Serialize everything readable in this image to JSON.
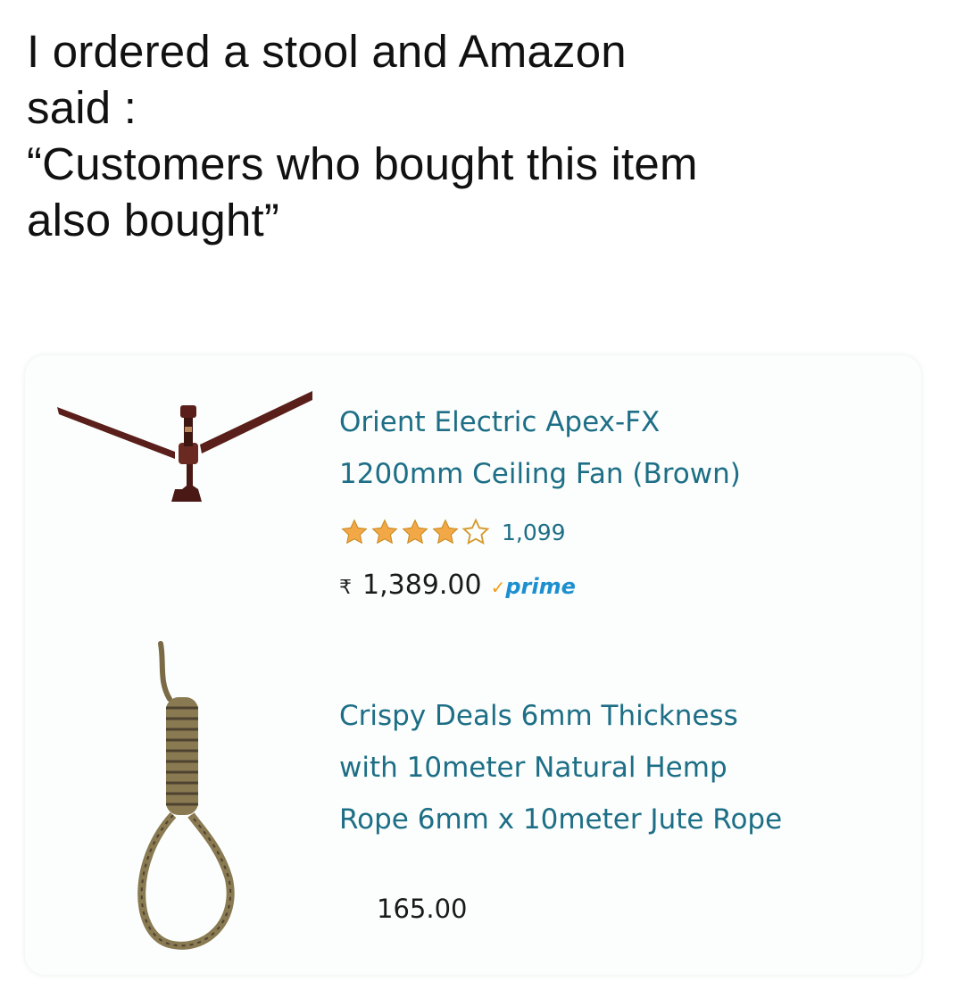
{
  "caption": "I ordered a stool and Amazon\nsaid :\n“Customers who bought this item\nalso bought”",
  "products": [
    {
      "title": "Orient Electric Apex-FX\n1200mm Ceiling Fan (Brown)",
      "rating": 4,
      "rating_max": 5,
      "review_count": "1,099",
      "currency_symbol": "₹",
      "price": "1,389.00",
      "prime_check": "✓",
      "prime_label": "prime",
      "image_icon": "ceiling-fan-icon"
    },
    {
      "title": "Crispy Deals 6mm Thickness\nwith 10meter Natural Hemp\nRope 6mm x 10meter Jute Rope",
      "price": "165.00",
      "image_icon": "rope-noose-icon"
    }
  ],
  "colors": {
    "title_link": "#1d6e86",
    "star_fill": "#f3a847",
    "prime_blue": "#1d8fd0",
    "prime_check": "#f39c12",
    "fan_brown": "#5a1f1a"
  }
}
